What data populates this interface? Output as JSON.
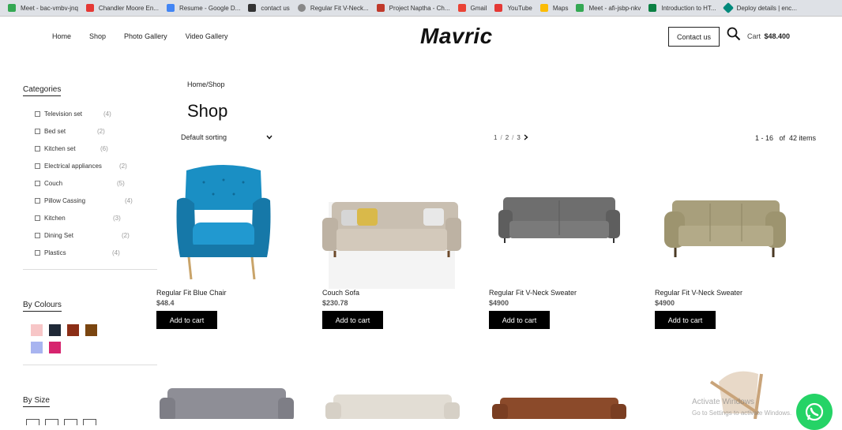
{
  "bookmarks": [
    {
      "label": "Meet - bac-vmbv-jnq",
      "color": "#34a853"
    },
    {
      "label": "Chandler Moore En...",
      "color": "#e53935"
    },
    {
      "label": "Resume - Google D...",
      "color": "#4285f4"
    },
    {
      "label": "contact us",
      "color": "#333333"
    },
    {
      "label": "Regular Fit V-Neck...",
      "color": "#888888"
    },
    {
      "label": "Project Naptha - Ch...",
      "color": "#c0392b"
    },
    {
      "label": "Gmail",
      "color": "#ea4335"
    },
    {
      "label": "YouTube",
      "color": "#e53935"
    },
    {
      "label": "Maps",
      "color": "#fbbc05"
    },
    {
      "label": "Meet - afi-jsbp-nkv",
      "color": "#34a853"
    },
    {
      "label": "Introduction to HT...",
      "color": "#0b8043"
    },
    {
      "label": "Deploy details | enc...",
      "color": "#00897b"
    }
  ],
  "nav": {
    "home": "Home",
    "shop": "Shop",
    "photo_gallery": "Photo Gallery",
    "video_gallery": "Video Gallery"
  },
  "logo": "Mavric",
  "contact_label": "Contact us",
  "cart": {
    "label": "Cart",
    "amount": "$48.400"
  },
  "sidebar": {
    "categories_title": "Categories",
    "categories": [
      {
        "name": "Television set",
        "count": "(4)"
      },
      {
        "name": "Bed set",
        "count": "(2)"
      },
      {
        "name": "Kitchen set",
        "count": "(6)"
      },
      {
        "name": "Electrical appliances",
        "count": "(2)"
      },
      {
        "name": "Couch",
        "count": "(5)"
      },
      {
        "name": "Pillow Cassing",
        "count": "(4)"
      },
      {
        "name": "Kitchen",
        "count": "(3)"
      },
      {
        "name": "Dining Set",
        "count": "(2)"
      },
      {
        "name": "Plastics",
        "count": "(4)"
      }
    ],
    "colours_title": "By Colours",
    "colours": [
      "#f7c6c7",
      "#1f2937",
      "#8b2e16",
      "#7a4510",
      "#a8b4f0",
      "#d6246e"
    ],
    "size_title": "By Size"
  },
  "breadcrumb": "Home/Shop",
  "page_title": "Shop",
  "sort_label": "Default sorting",
  "pager": {
    "p1": "1",
    "p2": "2",
    "p3": "3"
  },
  "items_count": "1 - 16   of  42 items",
  "products": [
    {
      "name": "Regular Fit Blue Chair",
      "price": "$48.4",
      "button": "Add to cart"
    },
    {
      "name": "Couch Sofa",
      "price": "$230.78",
      "button": "Add to cart"
    },
    {
      "name": "Regular Fit V-Neck Sweater",
      "price": "$4900",
      "button": "Add to cart"
    },
    {
      "name": "Regular Fit V-Neck Sweater",
      "price": "$4900",
      "button": "Add to cart"
    }
  ],
  "watermark": {
    "line1": "Activate Windows",
    "line2": "Go to Settings to activate Windows."
  }
}
